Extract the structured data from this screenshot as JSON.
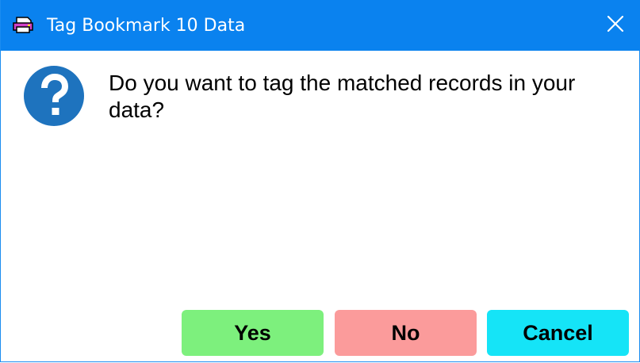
{
  "window": {
    "title": "Tag Bookmark 10 Data",
    "titlebar_color": "#0a82ef",
    "app_icon": "printer-icon",
    "close_icon": "close-icon"
  },
  "message": {
    "icon": "question-icon",
    "icon_color": "#1e73be",
    "text": "Do you want to tag the matched records in your data?"
  },
  "buttons": {
    "yes": {
      "label": "Yes",
      "color": "#7df07d"
    },
    "no": {
      "label": "No",
      "color": "#fb9b9b"
    },
    "cancel": {
      "label": "Cancel",
      "color": "#15e4f7"
    }
  }
}
